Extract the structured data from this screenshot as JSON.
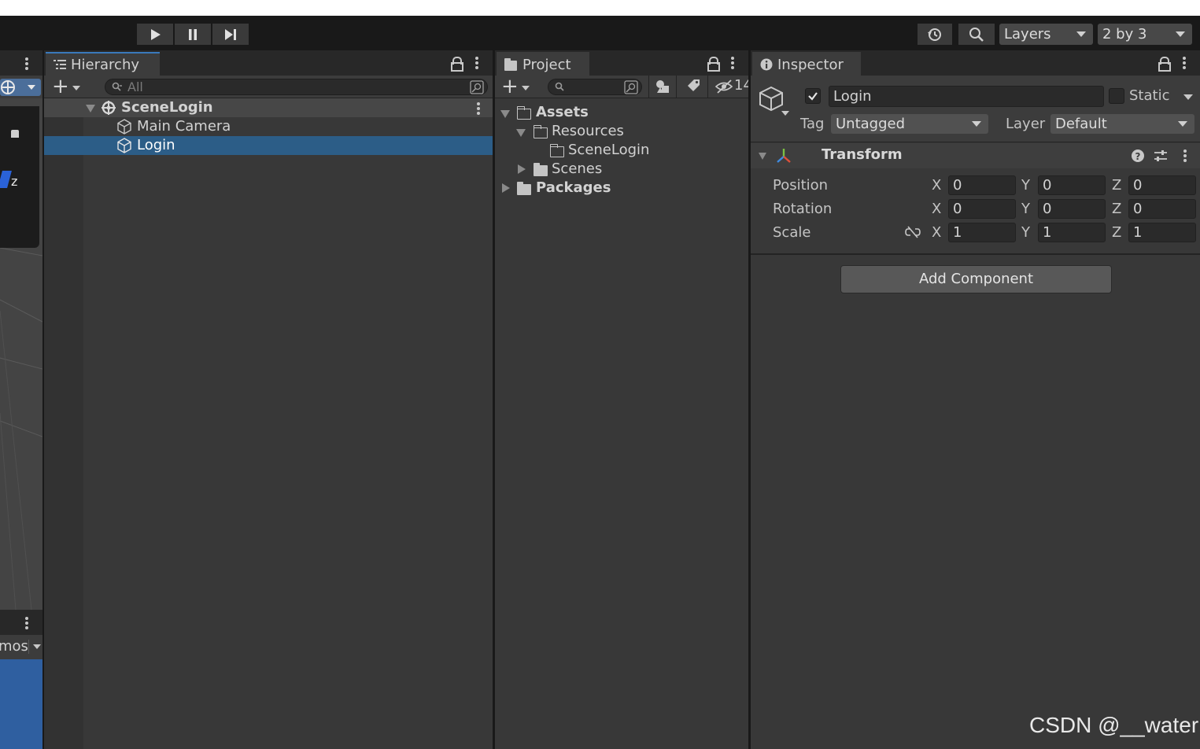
{
  "toolbar": {
    "play_icon": "play-icon",
    "pause_icon": "pause-icon",
    "step_icon": "step-icon",
    "history_icon": "history-icon",
    "search_icon": "search-icon",
    "layers_label": "Layers",
    "layout_label": "2 by 3"
  },
  "scene_view": {
    "axis_label": "z",
    "gizmos_label": "mos"
  },
  "hierarchy": {
    "tab_label": "Hierarchy",
    "search_placeholder": "All",
    "scene_name": "SceneLogin",
    "items": [
      {
        "label": "Main Camera",
        "selected": false
      },
      {
        "label": "Login",
        "selected": true
      }
    ]
  },
  "project": {
    "tab_label": "Project",
    "hidden_count": "14",
    "tree": {
      "assets": "Assets",
      "resources": "Resources",
      "scene_login": "SceneLogin",
      "scenes": "Scenes",
      "packages": "Packages"
    }
  },
  "inspector": {
    "tab_label": "Inspector",
    "object_name": "Login",
    "static_label": "Static",
    "tag_label": "Tag",
    "tag_value": "Untagged",
    "layer_label": "Layer",
    "layer_value": "Default",
    "transform": {
      "title": "Transform",
      "rows": [
        {
          "label": "Position",
          "x": "0",
          "y": "0",
          "z": "0"
        },
        {
          "label": "Rotation",
          "x": "0",
          "y": "0",
          "z": "0"
        },
        {
          "label": "Scale",
          "x": "1",
          "y": "1",
          "z": "1"
        }
      ],
      "axis_x": "X",
      "axis_y": "Y",
      "axis_z": "Z"
    },
    "add_component_label": "Add Component"
  },
  "watermark": "CSDN @__water",
  "colors": {
    "accent": "#3a79bb",
    "selection": "#2c5d87",
    "panel": "#383838",
    "toolbar": "#191919"
  }
}
